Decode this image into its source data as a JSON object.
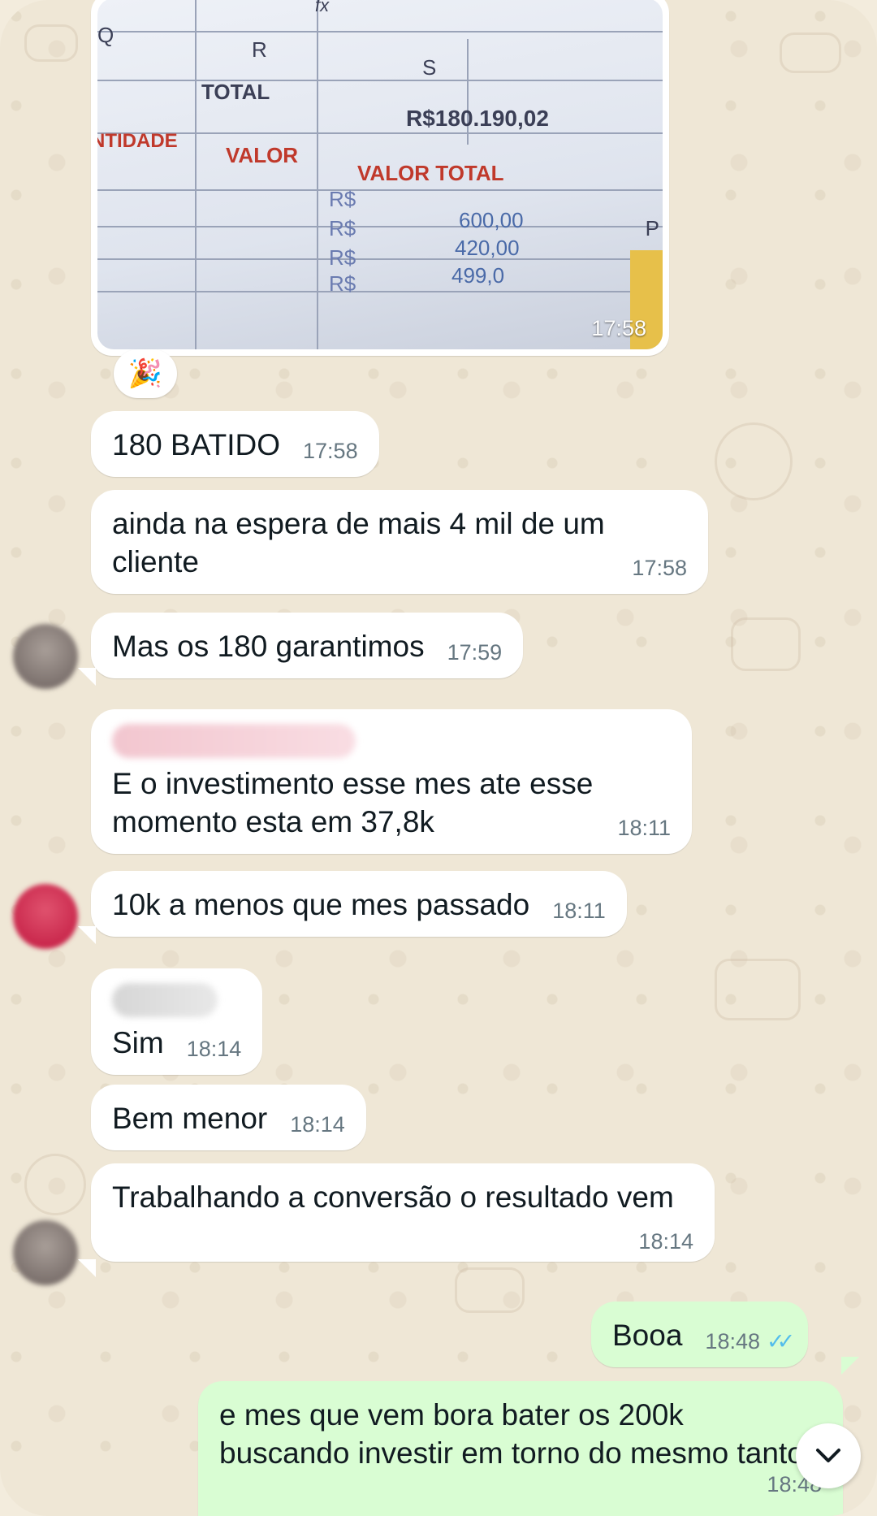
{
  "image_message": {
    "time": "17:58",
    "spreadsheet": {
      "col_q": "Q",
      "col_r": "R",
      "col_s": "S",
      "total_label": "TOTAL",
      "total_value": "R$180.190,02",
      "hdr_quantidade": "NTIDADE",
      "hdr_valor": "VALOR",
      "hdr_valor_total": "VALOR TOTAL",
      "currency": "R$",
      "rows": [
        "600,00",
        "420,00",
        "499,0"
      ],
      "fx": "fx",
      "side_letter": "P"
    },
    "reaction": "🎉"
  },
  "messages": [
    {
      "id": "m1",
      "text": "180 BATIDO",
      "time": "17:58"
    },
    {
      "id": "m2",
      "text": "ainda na espera de mais 4 mil de um cliente",
      "time": "17:58"
    },
    {
      "id": "m3",
      "text": "Mas os 180 garantimos",
      "time": "17:59"
    },
    {
      "id": "m4",
      "text": "E o investimento esse mes ate esse momento esta em 37,8k",
      "time": "18:11"
    },
    {
      "id": "m5",
      "text": "10k a menos que mes passado",
      "time": "18:11"
    },
    {
      "id": "m6",
      "text": "Sim",
      "time": "18:14"
    },
    {
      "id": "m7",
      "text": "Bem menor",
      "time": "18:14"
    },
    {
      "id": "m8",
      "text": "Trabalhando a conversão o resultado vem",
      "time": "18:14"
    },
    {
      "id": "m9",
      "text": "Booa",
      "time": "18:48",
      "status": "read"
    },
    {
      "id": "m10",
      "text": "e mes que vem bora bater os 200k buscando investir em torno do mesmo tanto",
      "time": "18:48"
    }
  ],
  "icons": {
    "read_ticks": "✓✓",
    "scroll_down": "chevron-down-icon"
  },
  "colors": {
    "incoming": "#ffffff",
    "outgoing": "#d9fdd3",
    "read_ticks": "#53bdeb",
    "wallpaper": "#efe7d6"
  }
}
